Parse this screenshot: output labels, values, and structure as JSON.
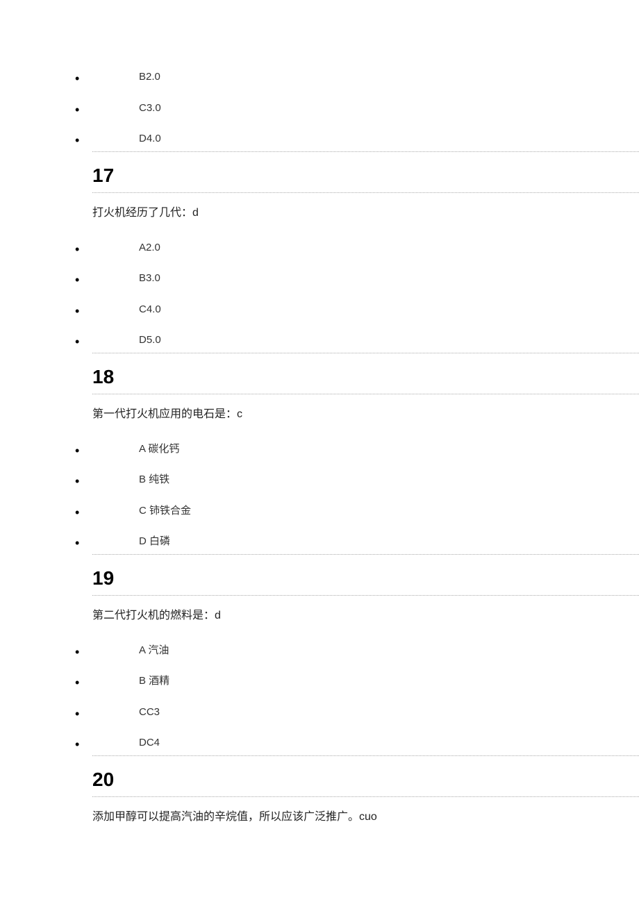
{
  "preOptions": [
    "B2.0",
    "C3.0",
    "D4.0"
  ],
  "questions": [
    {
      "number": "17",
      "text": "打火机经历了几代：d",
      "options": [
        "A2.0",
        "B3.0",
        "C4.0",
        "D5.0"
      ]
    },
    {
      "number": "18",
      "text": "第一代打火机应用的电石是：c",
      "options": [
        "A 碳化钙",
        "B 纯铁",
        "C 铈铁合金",
        "D 白磷"
      ]
    },
    {
      "number": "19",
      "text": "第二代打火机的燃料是：d",
      "options": [
        "A 汽油",
        "B 酒精",
        "CC3",
        "DC4"
      ]
    },
    {
      "number": "20",
      "text": "添加甲醇可以提高汽油的辛烷值，所以应该广泛推广。cuo",
      "options": []
    }
  ]
}
